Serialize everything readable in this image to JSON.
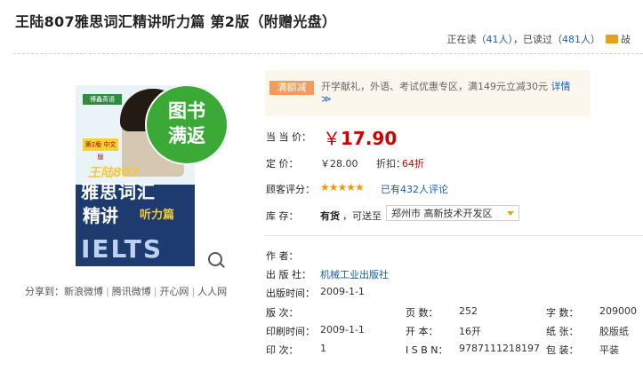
{
  "title": "王陆807雅思词汇精讲听力篇 第2版（附赠光盘）",
  "reading": {
    "prefix": "正在读（",
    "reading_count": "41人",
    "mid": "），已读过（",
    "read_count": "481人",
    "suffix": "）",
    "icon_label": "敁"
  },
  "cover": {
    "logo": "博鑫英语",
    "badge_line1": "图书",
    "badge_line2": "满返",
    "edition_tag": "第2版 中文版",
    "num": "王陆807",
    "line1": "雅思词汇",
    "line2": "精讲",
    "line3": "听力篇",
    "ielts": "IELTS"
  },
  "share": {
    "label": "分享到：",
    "items": [
      "新浪微博",
      "腾讯微博",
      "开心网",
      "人人网"
    ]
  },
  "promo": {
    "tag": "满额减",
    "text": "开学献礼，外语、考试优惠专区，满149元立减30元",
    "more": "详情",
    "more_arrow": "≫"
  },
  "price": {
    "label": "当 当 价：",
    "symbol": "￥",
    "value": "17.90"
  },
  "list_price": {
    "label": "定     价：",
    "value": "￥28.00",
    "discount_label": "折扣：",
    "discount": "64折"
  },
  "rating": {
    "label": "顾客评分：",
    "stars": 4.5,
    "stars_display": "★★★★★",
    "reviews": "已有432人评论"
  },
  "stock": {
    "label": "库     存：",
    "status": "有货",
    "ship_to": "，可送至",
    "location": "郑州市  高新技术开发区"
  },
  "details": {
    "author_label": "作     者：",
    "author": "",
    "publisher_label": "出 版 社：",
    "publisher": "机械工业出版社",
    "pubdate_label": "出版时间：",
    "pubdate": "2009-1-1",
    "edition_label": "版     次：",
    "edition": "",
    "pages_label": "页     数：",
    "pages": "252",
    "words_label": "字     数：",
    "words": "209000",
    "printdate_label": "印刷时间：",
    "printdate": "2009-1-1",
    "format_label": "开     本：",
    "format": "16开",
    "paper_label": "纸     张：",
    "paper": "胶版纸",
    "printing_label": "印     次：",
    "printing": "1",
    "isbn_label": "I S B N：",
    "isbn": "9787111218197",
    "binding_label": "包     装：",
    "binding": "平装"
  },
  "colors": {
    "price_red": "#cc0000",
    "link_blue": "#1a5fb4",
    "badge_green": "#3aa935",
    "promo_tag": "#f49a5c"
  }
}
